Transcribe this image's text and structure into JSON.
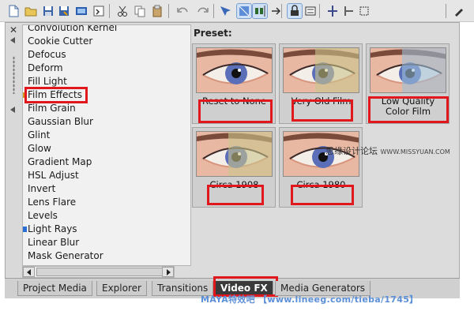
{
  "toolbar": {
    "icons": [
      "new-file-icon",
      "open-folder-icon",
      "save-icon",
      "save-as-icon",
      "render-icon",
      "properties-icon",
      "cut-icon",
      "copy-icon",
      "paste-icon",
      "undo-icon",
      "redo-icon",
      "normal-edit-tool-icon",
      "selection-tool-icon",
      "snap-icon",
      "auto-ripple-icon",
      "lock-envelopes-icon",
      "ignore-grouping-icon",
      "split-icon",
      "trim-start-icon",
      "trim-end-icon",
      "paint-icon"
    ]
  },
  "effects": {
    "items": [
      {
        "label": "Convolution Kernel",
        "marker": "none"
      },
      {
        "label": "Cookie Cutter",
        "marker": "none"
      },
      {
        "label": "Defocus",
        "marker": "none"
      },
      {
        "label": "Deform",
        "marker": "none"
      },
      {
        "label": "Fill Light",
        "marker": "none"
      },
      {
        "label": "Film Effects",
        "marker": "yellow",
        "selected": true
      },
      {
        "label": "Film Grain",
        "marker": "none"
      },
      {
        "label": "Gaussian Blur",
        "marker": "none"
      },
      {
        "label": "Glint",
        "marker": "none"
      },
      {
        "label": "Glow",
        "marker": "none"
      },
      {
        "label": "Gradient Map",
        "marker": "none"
      },
      {
        "label": "HSL Adjust",
        "marker": "none"
      },
      {
        "label": "Invert",
        "marker": "none"
      },
      {
        "label": "Lens Flare",
        "marker": "none"
      },
      {
        "label": "Levels",
        "marker": "none"
      },
      {
        "label": "Light Rays",
        "marker": "blue"
      },
      {
        "label": "Linear Blur",
        "marker": "none"
      },
      {
        "label": "Mask Generator",
        "marker": "none"
      }
    ]
  },
  "preset": {
    "title": "Preset:",
    "tiles": [
      {
        "label": "Reset to None",
        "style": "natural"
      },
      {
        "label": "Very Old Film",
        "style": "old"
      },
      {
        "label": "Low Quality Color Film",
        "style": "lowq"
      },
      {
        "label": "Circa 1908",
        "style": "old"
      },
      {
        "label": "Circa 1980",
        "style": "natural"
      }
    ]
  },
  "tabs": [
    {
      "label": "Project Media",
      "active": false
    },
    {
      "label": "Explorer",
      "active": false
    },
    {
      "label": "Transitions",
      "active": false
    },
    {
      "label": "Video FX",
      "active": true
    },
    {
      "label": "Media Generators",
      "active": false
    }
  ],
  "watermarks": {
    "line1_cn": "思缘设计论坛",
    "line1_en": "WWW.MISSYUAN.COM",
    "line2": "MAYA特效吧 【www.lineeg.com/tieba/1745】"
  },
  "colors": {
    "highlight_red": "#e0181d",
    "tab_active_bg": "#3a3a3a",
    "watermark_blue": "#5b8fd8"
  }
}
